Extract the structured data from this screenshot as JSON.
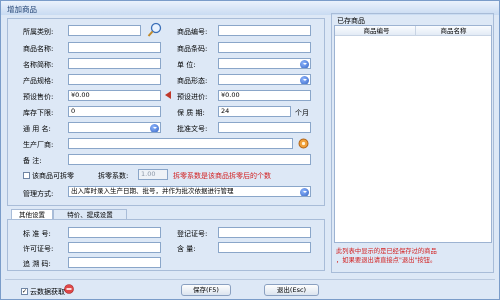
{
  "window": {
    "title": "增加商品"
  },
  "form": {
    "category_label": "所属类别:",
    "product_no_label": "商品编号:",
    "product_name_label": "商品名称:",
    "product_code_label": "商品条码:",
    "short_name_label": "名称简称:",
    "unit_label": "单   位:",
    "spec_label": "产品规格:",
    "form_label": "商品形态:",
    "purchase_price_label": "预设售价:",
    "purchase_price_value": "¥0.00",
    "sale_price_label": "预设进价:",
    "sale_price_value": "¥0.00",
    "stock_min_label": "库存下限:",
    "stock_min_value": "0",
    "shelf_life_label": "保 质 期:",
    "shelf_life_value": "24",
    "shelf_life_unit": "个月",
    "common_name_label": "通 用 名:",
    "approval_label": "批准文号:",
    "manufacturer_label": "生产厂商:",
    "remark_label": "备    注:",
    "split_checkbox_label": "该商品可拆零",
    "split_ratio_label": "拆零系数:",
    "split_ratio_value": "1.00",
    "split_hint": "拆零系数是该商品拆零后的个数",
    "manage_label": "管理方式:",
    "manage_value": "出入库时录入生产日期、批号，并作为批次依据进行管理"
  },
  "tabs": [
    {
      "label": "其他设置"
    },
    {
      "label": "特价、提成设置"
    }
  ],
  "other": {
    "standard_label": "标 准 号:",
    "reg_cert_label": "登记证号:",
    "license_label": "许可证号:",
    "content_label": "含    量:",
    "trace_label": "追 溯 码:"
  },
  "existing": {
    "title": "已存商品",
    "columns": [
      "商品编号",
      "商品名称"
    ],
    "hint_line1": "此列表中显示的是已经保存过的商品",
    "hint_line2": "，如果要退出请直接点\"退出\"按钮。"
  },
  "footer": {
    "cloud_checkbox_label": "云数据获取",
    "save_button": "保存(F5)",
    "exit_button": "退出(Esc)"
  },
  "colors": {
    "accent_red": "#d21d1d",
    "window_bg": "#dde8f6"
  }
}
